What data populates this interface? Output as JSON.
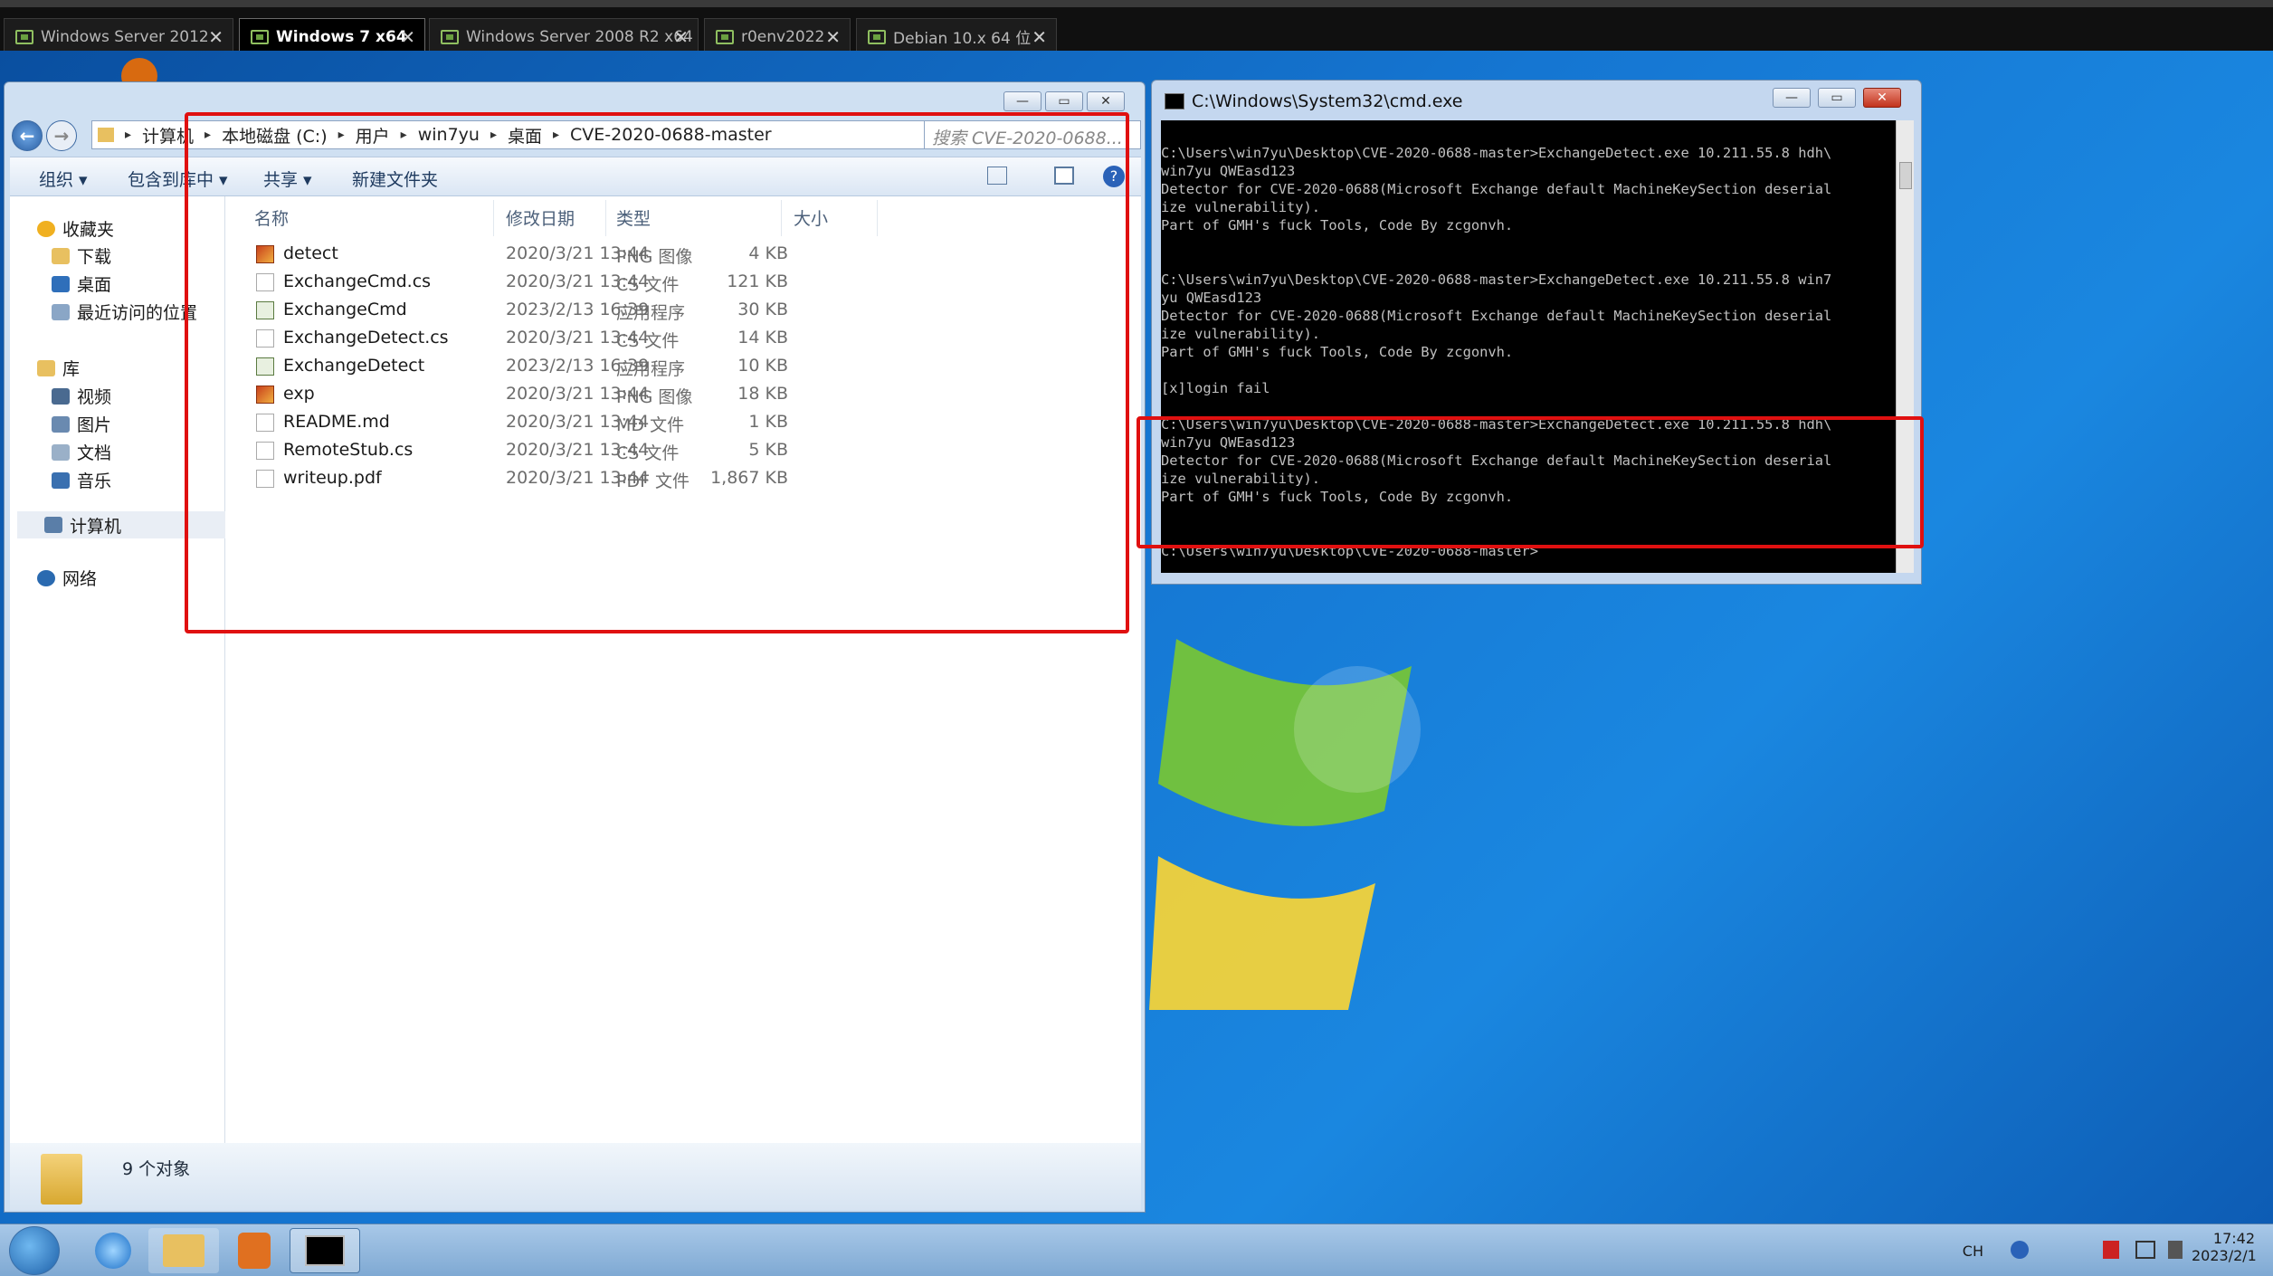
{
  "vm_tabs": [
    {
      "label": "Windows Server 2012",
      "close": "✕"
    },
    {
      "label": "Windows 7 x64",
      "close": "✕"
    },
    {
      "label": "Windows Server 2008 R2 x64",
      "close": "✕"
    },
    {
      "label": "r0env2022",
      "close": "✕"
    },
    {
      "label": "Debian 10.x 64 位",
      "close": "✕"
    }
  ],
  "explorer": {
    "breadcrumb": [
      "计算机",
      "本地磁盘 (C:)",
      "用户",
      "win7yu",
      "桌面",
      "CVE-2020-0688-master"
    ],
    "search_placeholder": "搜索 CVE-2020-0688...",
    "toolbar": {
      "organize": "组织 ▾",
      "include": "包含到库中 ▾",
      "share": "共享 ▾",
      "new_folder": "新建文件夹"
    },
    "nav": {
      "favorites": "收藏夹",
      "downloads": "下载",
      "desktop": "桌面",
      "recent": "最近访问的位置",
      "libraries": "库",
      "videos": "视频",
      "pictures": "图片",
      "documents": "文档",
      "music": "音乐",
      "computer": "计算机",
      "network": "网络"
    },
    "columns": {
      "name": "名称",
      "date": "修改日期",
      "type": "类型",
      "size": "大小"
    },
    "files": [
      {
        "name": "detect",
        "date": "2020/3/21 13:44",
        "type": "PNG 图像",
        "size": "4 KB",
        "icon": "png"
      },
      {
        "name": "ExchangeCmd.cs",
        "date": "2020/3/21 13:44",
        "type": "CS 文件",
        "size": "121 KB",
        "icon": "doc"
      },
      {
        "name": "ExchangeCmd",
        "date": "2023/2/13 16:39",
        "type": "应用程序",
        "size": "30 KB",
        "icon": "exe"
      },
      {
        "name": "ExchangeDetect.cs",
        "date": "2020/3/21 13:44",
        "type": "CS 文件",
        "size": "14 KB",
        "icon": "doc"
      },
      {
        "name": "ExchangeDetect",
        "date": "2023/2/13 16:39",
        "type": "应用程序",
        "size": "10 KB",
        "icon": "exe"
      },
      {
        "name": "exp",
        "date": "2020/3/21 13:44",
        "type": "PNG 图像",
        "size": "18 KB",
        "icon": "png"
      },
      {
        "name": "README.md",
        "date": "2020/3/21 13:44",
        "type": "MD 文件",
        "size": "1 KB",
        "icon": "doc"
      },
      {
        "name": "RemoteStub.cs",
        "date": "2020/3/21 13:44",
        "type": "CS 文件",
        "size": "5 KB",
        "icon": "doc"
      },
      {
        "name": "writeup.pdf",
        "date": "2020/3/21 13:44",
        "type": "PDF 文件",
        "size": "1,867 KB",
        "icon": "doc"
      }
    ],
    "status": "9 个对象"
  },
  "cmd": {
    "title": "C:\\Windows\\System32\\cmd.exe",
    "lines": [
      "",
      "C:\\Users\\win7yu\\Desktop\\CVE-2020-0688-master>ExchangeDetect.exe 10.211.55.8 hdh\\",
      "win7yu QWEasd123",
      "Detector for CVE-2020-0688(Microsoft Exchange default MachineKeySection deserial",
      "ize vulnerability).",
      "Part of GMH's fuck Tools, Code By zcgonvh.",
      "",
      "",
      "C:\\Users\\win7yu\\Desktop\\CVE-2020-0688-master>ExchangeDetect.exe 10.211.55.8 win7",
      "yu QWEasd123",
      "Detector for CVE-2020-0688(Microsoft Exchange default MachineKeySection deserial",
      "ize vulnerability).",
      "Part of GMH's fuck Tools, Code By zcgonvh.",
      "",
      "[x]login fail",
      "",
      "C:\\Users\\win7yu\\Desktop\\CVE-2020-0688-master>ExchangeDetect.exe 10.211.55.8 hdh\\",
      "win7yu QWEasd123",
      "Detector for CVE-2020-0688(Microsoft Exchange default MachineKeySection deserial",
      "ize vulnerability).",
      "Part of GMH's fuck Tools, Code By zcgonvh.",
      "",
      "",
      "C:\\Users\\win7yu\\Desktop\\CVE-2020-0688-master>"
    ]
  },
  "tray": {
    "lang": "CH",
    "time": "17:42",
    "date": "2023/2/1"
  }
}
